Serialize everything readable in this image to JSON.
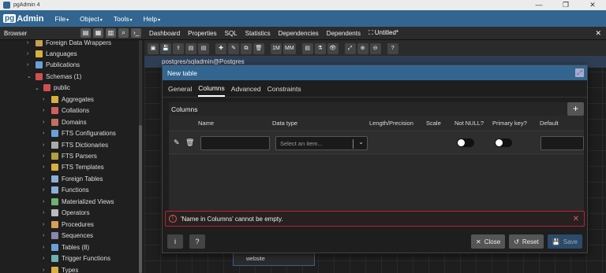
{
  "window": {
    "title": "pgAdmin 4",
    "controls": [
      "—",
      "❐",
      "✕"
    ]
  },
  "menubar": {
    "logo_pg": "pg",
    "logo_text": "Admin",
    "items": [
      "File",
      "Object",
      "Tools",
      "Help"
    ]
  },
  "browser": {
    "label": "Browser"
  },
  "tabs": [
    "Dashboard",
    "Properties",
    "SQL",
    "Statistics",
    "Dependencies",
    "Dependents",
    "Untitled*"
  ],
  "tree": [
    {
      "label": "Foreign Data Wrappers",
      "indent": 1,
      "color": "#c8a050"
    },
    {
      "label": "Languages",
      "indent": 1,
      "color": "#d8b040"
    },
    {
      "label": "Publications",
      "indent": 1,
      "color": "#6aa0d8"
    },
    {
      "label": "Schemas (1)",
      "indent": 1,
      "color": "#d05050"
    },
    {
      "label": "public",
      "indent": 2,
      "color": "#d05050"
    },
    {
      "label": "Aggregates",
      "indent": 3,
      "color": "#d8b040"
    },
    {
      "label": "Collations",
      "indent": 3,
      "color": "#d06060"
    },
    {
      "label": "Domains",
      "indent": 3,
      "color": "#c07060"
    },
    {
      "label": "FTS Configurations",
      "indent": 3,
      "color": "#6aa0d8"
    },
    {
      "label": "FTS Dictionaries",
      "indent": 3,
      "color": "#aaaaaa"
    },
    {
      "label": "FTS Parsers",
      "indent": 3,
      "color": "#b0a040"
    },
    {
      "label": "FTS Templates",
      "indent": 3,
      "color": "#d8b040"
    },
    {
      "label": "Foreign Tables",
      "indent": 3,
      "color": "#8ab0d8"
    },
    {
      "label": "Functions",
      "indent": 3,
      "color": "#8ab0d8"
    },
    {
      "label": "Materialized Views",
      "indent": 3,
      "color": "#70b070"
    },
    {
      "label": "Operators",
      "indent": 3,
      "color": "#bbbbbb"
    },
    {
      "label": "Procedures",
      "indent": 3,
      "color": "#d8a050"
    },
    {
      "label": "Sequences",
      "indent": 3,
      "color": "#8888aa"
    },
    {
      "label": "Tables (8)",
      "indent": 3,
      "color": "#6aa0d8"
    },
    {
      "label": "Trigger Functions",
      "indent": 3,
      "color": "#70b0b0"
    },
    {
      "label": "Types",
      "indent": 3,
      "color": "#d8b040"
    }
  ],
  "erd_toolbar": [
    "▣",
    "💾",
    "⇪",
    "▤",
    "▤",
    "✚",
    "✎",
    "⧉",
    "🗑",
    "1M",
    "MM",
    "▤",
    "⚗",
    "👁",
    "⤢",
    "⊕",
    "⊖",
    "?"
  ],
  "connection": "postgres/sqladmin@Postgres",
  "entity_label": "website",
  "dialog": {
    "title": "New table",
    "tabs": [
      "General",
      "Columns",
      "Advanced",
      "Constraints"
    ],
    "active_tab": "Columns",
    "columns_title": "Columns",
    "add_label": "+",
    "headers": [
      "Name",
      "Data type",
      "Length/Precision",
      "Scale",
      "Not NULL?",
      "Primary key?",
      "Default"
    ],
    "type_placeholder": "Select an item...",
    "error": "'Name in Columns' cannot be empty.",
    "buttons": {
      "close": "Close",
      "reset": "Reset",
      "save": "Save",
      "info": "i",
      "help": "?"
    }
  }
}
